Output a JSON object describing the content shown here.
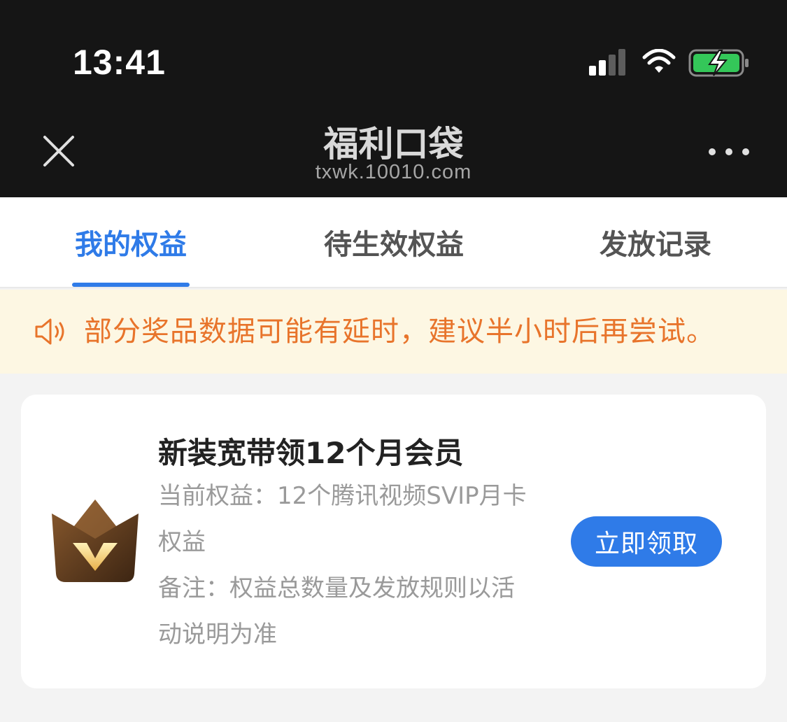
{
  "status_bar": {
    "time": "13:41",
    "signal_icon": "cellular-signal-icon",
    "wifi_icon": "wifi-icon",
    "battery_icon": "battery-charging-icon",
    "battery_color": "#34c759"
  },
  "nav": {
    "title": "福利口袋",
    "url": "txwk.10010.com",
    "close_icon": "close-icon",
    "more_icon": "more-icon"
  },
  "tabs": [
    {
      "label": "我的权益",
      "active": true
    },
    {
      "label": "待生效权益",
      "active": false
    },
    {
      "label": "发放记录",
      "active": false
    }
  ],
  "notice": {
    "icon": "speaker-icon",
    "text": "部分奖品数据可能有延时，建议半小时后再尝试。"
  },
  "benefit_card": {
    "logo": "tencent-video-vip-logo",
    "title": "新装宽带领12个月会员",
    "current_line1": "当前权益：12个腾讯视频SVIP月卡",
    "current_line2": "权益",
    "note_line1": "备注：权益总数量及发放规则以活",
    "note_line2": "动说明为准",
    "claim_label": "立即领取"
  },
  "colors": {
    "accent": "#2f7be8",
    "notice_text": "#e8742b",
    "notice_bg": "#fdf7e3",
    "header_bg": "#151515"
  }
}
